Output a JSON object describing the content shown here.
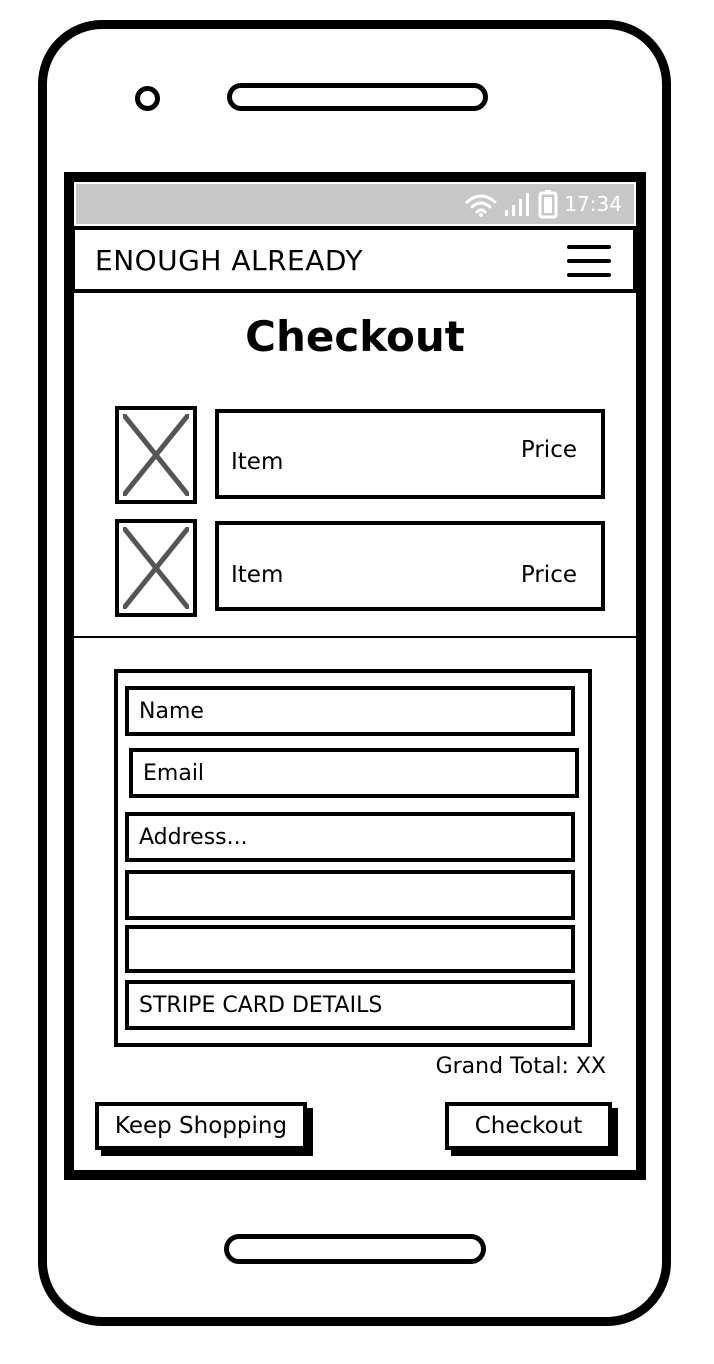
{
  "status_bar": {
    "time": "17:34",
    "icons": [
      "wifi-icon",
      "signal-icon",
      "battery-icon"
    ]
  },
  "header": {
    "brand": "ENOUGH ALREADY",
    "menu_icon": "hamburger-menu-icon"
  },
  "page": {
    "title": "Checkout"
  },
  "cart": {
    "items": [
      {
        "label": "Item",
        "price": "Price"
      },
      {
        "label": "Item",
        "price": "Price"
      }
    ]
  },
  "form": {
    "name_placeholder": "Name",
    "email_placeholder": "Email",
    "address_placeholder": "Address...",
    "address2_placeholder": "",
    "address3_placeholder": "",
    "card_placeholder": "STRIPE CARD DETAILS"
  },
  "summary": {
    "grand_total": "Grand Total: XX"
  },
  "actions": {
    "keep_shopping": "Keep Shopping",
    "checkout": "Checkout"
  },
  "colors": {
    "status_bar": "#c7c7c7",
    "outline": "#000000",
    "placeholder_x": "#555555"
  }
}
